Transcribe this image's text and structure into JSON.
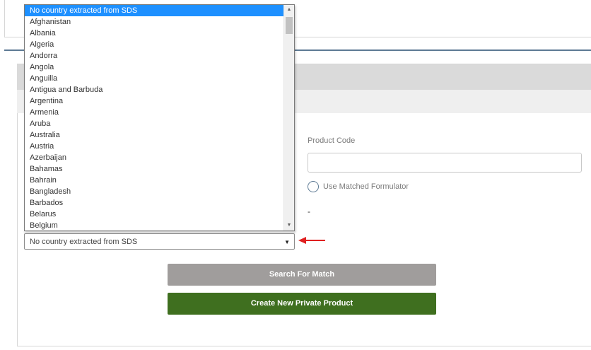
{
  "product_code": {
    "label": "Product Code",
    "value": "",
    "placeholder": ""
  },
  "matched_formulator": {
    "label": "Use Matched Formulator",
    "checked": false
  },
  "dash_text": "-",
  "country_select": {
    "selected": "No country extracted from SDS",
    "options": [
      "No country extracted from SDS",
      "Afghanistan",
      "Albania",
      "Algeria",
      "Andorra",
      "Angola",
      "Anguilla",
      "Antigua and Barbuda",
      "Argentina",
      "Armenia",
      "Aruba",
      "Australia",
      "Austria",
      "Azerbaijan",
      "Bahamas",
      "Bahrain",
      "Bangladesh",
      "Barbados",
      "Belarus",
      "Belgium"
    ]
  },
  "buttons": {
    "search": "Search For Match",
    "create": "Create New Private Product"
  },
  "icons": {
    "select_caret": "caret-down-icon",
    "scroll_up": "scroll-up-icon",
    "scroll_down": "scroll-down-icon",
    "annotation": "red-arrow-icon"
  },
  "colors": {
    "selected_option": "#1e90ff",
    "search_button": "#a09d9c",
    "create_button": "#3f6f1f",
    "annotation_arrow": "#e02020",
    "divider": "#5d7a94"
  }
}
